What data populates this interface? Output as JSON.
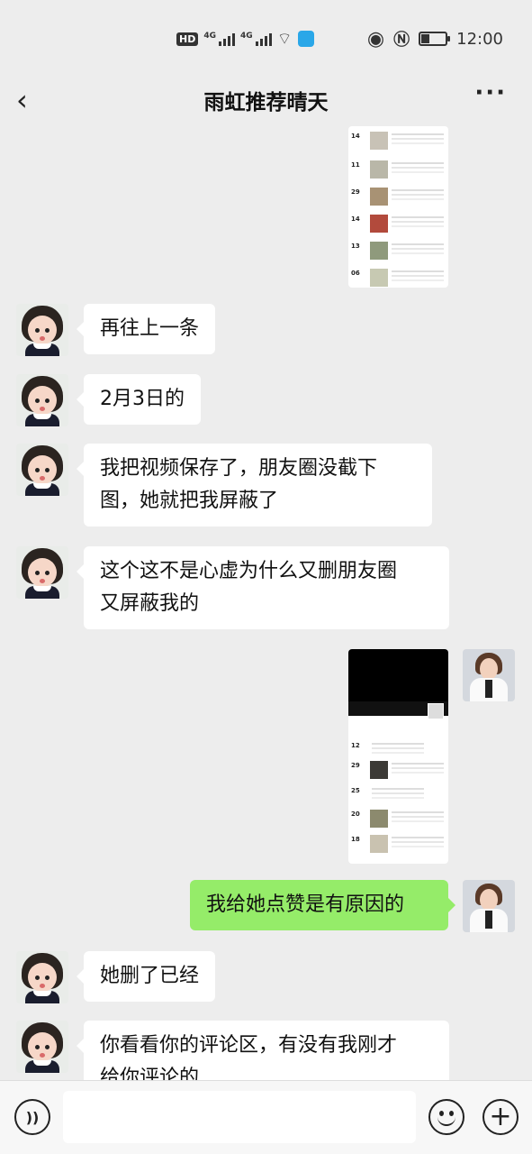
{
  "status_bar": {
    "hd_label": "HD",
    "sim1_label": "4G",
    "sim2_label": "4G",
    "eye_icon": "eye-icon",
    "nfc_icon": "nfc-icon",
    "time": "12:00"
  },
  "header": {
    "back_icon": "chevron-left-icon",
    "title": "雨虹推荐晴天",
    "more_icon": "more-horizontal-icon"
  },
  "messages": [
    {
      "side": "right",
      "type": "image",
      "description_icon": "screenshot-image"
    },
    {
      "side": "left",
      "type": "text",
      "text": "再往上一条"
    },
    {
      "side": "left",
      "type": "text",
      "text": "2月3日的"
    },
    {
      "side": "left",
      "type": "text",
      "lines": [
        "我把视频保存了，朋友圈没截下",
        "图，她就把我屏蔽了"
      ]
    },
    {
      "side": "left",
      "type": "text",
      "lines": [
        "这个这不是心虚为什么又删朋友圈",
        "又屏蔽我的"
      ]
    },
    {
      "side": "right",
      "type": "image",
      "description_icon": "screenshot-image"
    },
    {
      "side": "right",
      "type": "text",
      "text": "我给她点赞是有原因的"
    },
    {
      "side": "left",
      "type": "text",
      "text": "她删了已经"
    },
    {
      "side": "left",
      "type": "text",
      "lines": [
        "你看看你的评论区，有没有我刚才",
        "给你评论的"
      ]
    }
  ],
  "screenshot1": {
    "dates": [
      "14",
      "11",
      "29",
      "14",
      "13",
      "06"
    ]
  },
  "screenshot2": {
    "dates": [
      "12",
      "29",
      "25",
      "20",
      "18"
    ]
  },
  "input_bar": {
    "voice_icon": "voice-icon",
    "emoji_icon": "emoji-icon",
    "plus_icon": "plus-icon"
  },
  "colors": {
    "background": "#ededed",
    "own_bubble": "#95ec69",
    "other_bubble": "#ffffff"
  }
}
